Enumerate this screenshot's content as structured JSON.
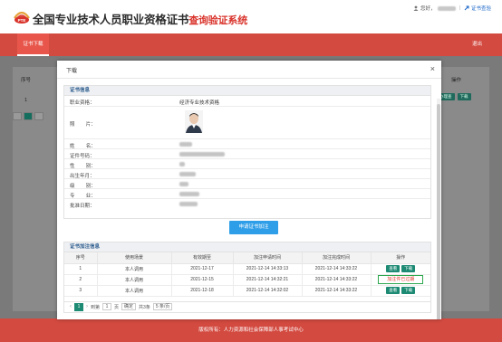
{
  "header": {
    "logo_text": "PTE",
    "title_main": "全国专业技术人员职业资格证书",
    "title_sub": "查询验证系统",
    "greeting": "您好，",
    "verify_link": "证书查验"
  },
  "navbar": {
    "active_tab": "证书下载",
    "exit_label": "退出"
  },
  "background": {
    "col_seq": "序号",
    "row_one": "1",
    "col_op": "操作",
    "btn_view": "办理查",
    "btn_download": "下载",
    "page_current": "1"
  },
  "modal": {
    "title": "下载",
    "close_icon": "×",
    "cert_section_title": "证书信息",
    "fields": [
      {
        "label": "职业资格：",
        "value": "经济专业技术资格"
      },
      {
        "label": "照        片：",
        "value": ""
      },
      {
        "label": "姓        名：",
        "value": ""
      },
      {
        "label": "证件号码：",
        "value": ""
      },
      {
        "label": "性        别：",
        "value": ""
      },
      {
        "label": "出生年月：",
        "value": ""
      },
      {
        "label": "级        别：",
        "value": ""
      },
      {
        "label": "专        业：",
        "value": ""
      },
      {
        "label": "批准日期：",
        "value": ""
      }
    ],
    "apply_button": "申请证书加注",
    "ext_section_title": "证书加注信息",
    "ext_columns": [
      "序号",
      "使用场景",
      "有效期至",
      "加注申请时间",
      "加注完成时间",
      "操作"
    ],
    "ext_rows": [
      {
        "seq": "1",
        "scene": "本人调用",
        "valid": "2021-12-17",
        "apply_time": "2021-12-14 14:33:13",
        "done_time": "2021-12-14 14:33:22",
        "status": "buttons"
      },
      {
        "seq": "2",
        "scene": "本人调用",
        "valid": "2021-12-15",
        "apply_time": "2021-12-14 14:32:21",
        "done_time": "2021-12-14 14:33:22",
        "status": "expired"
      },
      {
        "seq": "3",
        "scene": "本人调用",
        "valid": "2021-12-18",
        "apply_time": "2021-12-14 14:32:02",
        "done_time": "2021-12-14 14:33:22",
        "status": "buttons"
      }
    ],
    "btn_view": "查看",
    "btn_download": "下载",
    "expired_label": "加注件已过期",
    "pager": {
      "current": "1",
      "goto_label": "到第",
      "page_input": "1",
      "page_unit": "页",
      "ok": "确定",
      "total": "共3条",
      "per_page": "5 条/页"
    }
  },
  "footer": {
    "text": "版权所有：人力资源和社会保障部人事考试中心"
  },
  "colors": {
    "brand_red": "#d34a40",
    "accent_blue": "#2f9ee8",
    "action_green": "#1d8a74"
  }
}
